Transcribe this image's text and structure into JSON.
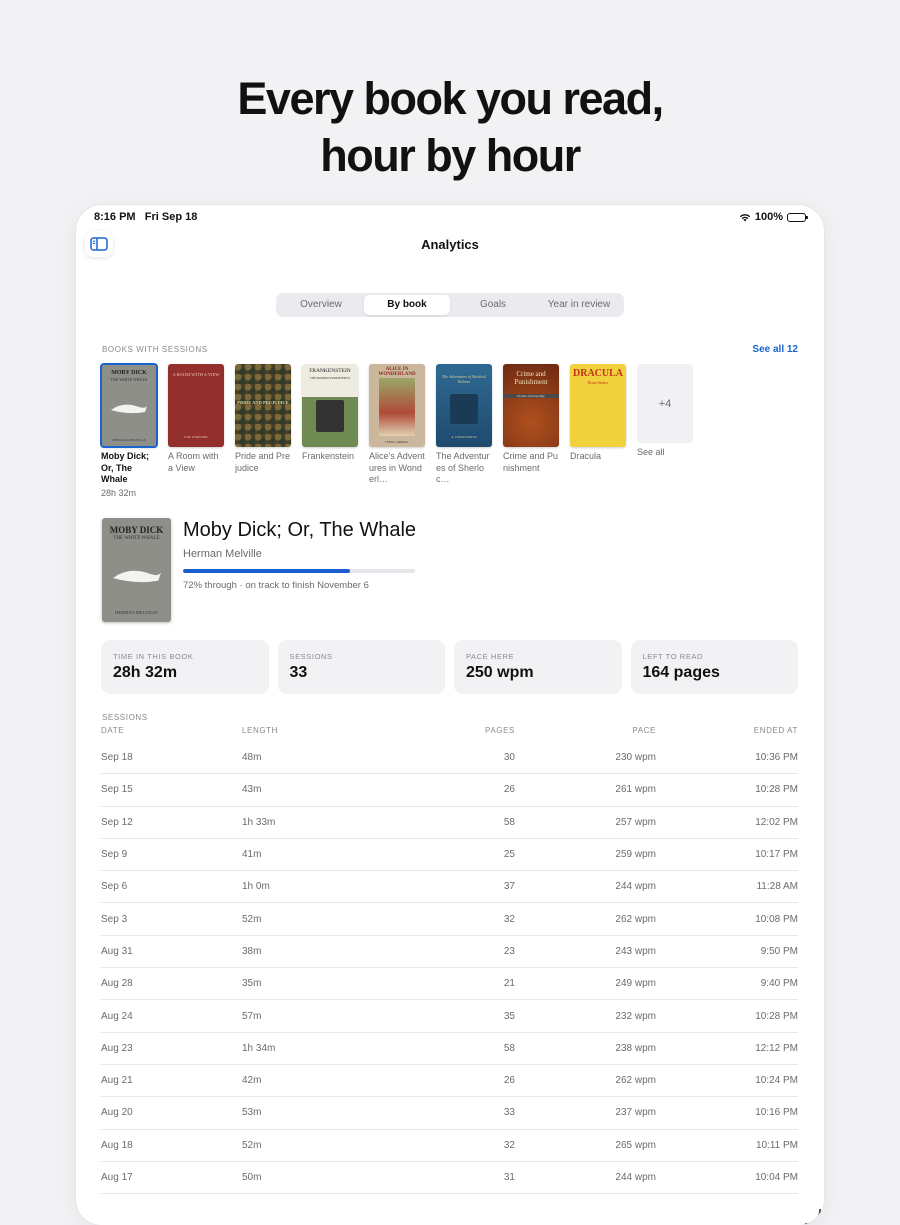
{
  "headline": {
    "line1": "Every book you read,",
    "line2": "hour by hour"
  },
  "status": {
    "time": "8:16 PM",
    "date": "Fri Sep 18",
    "battery": "100%"
  },
  "nav": {
    "title": "Analytics"
  },
  "tabs": [
    {
      "label": "Overview",
      "active": false
    },
    {
      "label": "By book",
      "active": true
    },
    {
      "label": "Goals",
      "active": false
    },
    {
      "label": "Year in review",
      "active": false
    }
  ],
  "books_section": {
    "label": "BOOKS WITH SESSIONS",
    "see_all": "See all 12"
  },
  "books": [
    {
      "title": "Moby Dick; Or, The Whale",
      "hours": "28h 32m",
      "cover_text": "MOBY DICK",
      "cover_color": "#8a8a86"
    },
    {
      "title": "A Room with a View",
      "cover_text": "A ROOM WITH A VIEW",
      "cover_color": "#8e2b2a"
    },
    {
      "title": "Pride and Prejudice",
      "cover_text": "PRIDE AND PREJUDICE",
      "cover_color": "#5a4a2a"
    },
    {
      "title": "Frankenstein",
      "cover_text": "FRANKENSTEIN",
      "cover_color": "#e9e6dc"
    },
    {
      "title": "Alice's Adventures in Wonderl…",
      "cover_text": "ALICE IN WONDERLAND",
      "cover_color": "#c8b8a0"
    },
    {
      "title": "The Adventures of Sherloc…",
      "cover_text": "THE ADVENTURES OF SHERLOCK HOLMES",
      "cover_color": "#2a5f86"
    },
    {
      "title": "Crime and Punishment",
      "cover_text": "Crime and Punishment",
      "cover_color": "#8c3a1c"
    },
    {
      "title": "Dracula",
      "cover_text": "DRACULA",
      "cover_color": "#f0d040"
    }
  ],
  "more": {
    "count": "+4",
    "label": "See all"
  },
  "detail": {
    "title": "Moby Dick; Or, The Whale",
    "author": "Herman Melville",
    "progress": 0.72,
    "progress_text": "72% through · on track to finish November 6"
  },
  "stats": [
    {
      "label": "TIME IN THIS BOOK",
      "value": "28h 32m"
    },
    {
      "label": "SESSIONS",
      "value": "33"
    },
    {
      "label": "PACE HERE",
      "value": "250 wpm"
    },
    {
      "label": "LEFT TO READ",
      "value": "164 pages"
    }
  ],
  "sessions": {
    "label": "SESSIONS",
    "columns": [
      "DATE",
      "LENGTH",
      "PAGES",
      "PACE",
      "ENDED AT"
    ],
    "rows": [
      [
        "Sep 18",
        "48m",
        "30",
        "230 wpm",
        "10:36 PM"
      ],
      [
        "Sep 15",
        "43m",
        "26",
        "261 wpm",
        "10:28 PM"
      ],
      [
        "Sep 12",
        "1h 33m",
        "58",
        "257 wpm",
        "12:02 PM"
      ],
      [
        "Sep 9",
        "41m",
        "25",
        "259 wpm",
        "10:17 PM"
      ],
      [
        "Sep 6",
        "1h 0m",
        "37",
        "244 wpm",
        "11:28 AM"
      ],
      [
        "Sep 3",
        "52m",
        "32",
        "262 wpm",
        "10:08 PM"
      ],
      [
        "Aug 31",
        "38m",
        "23",
        "243 wpm",
        "9:50 PM"
      ],
      [
        "Aug 28",
        "35m",
        "21",
        "249 wpm",
        "9:40 PM"
      ],
      [
        "Aug 24",
        "57m",
        "35",
        "232 wpm",
        "10:28 PM"
      ],
      [
        "Aug 23",
        "1h 34m",
        "58",
        "238 wpm",
        "12:12 PM"
      ],
      [
        "Aug 21",
        "42m",
        "26",
        "262 wpm",
        "10:24 PM"
      ],
      [
        "Aug 20",
        "53m",
        "33",
        "237 wpm",
        "10:16 PM"
      ],
      [
        "Aug 18",
        "52m",
        "32",
        "265 wpm",
        "10:11 PM"
      ],
      [
        "Aug 17",
        "50m",
        "31",
        "244 wpm",
        "10:04 PM"
      ]
    ]
  },
  "colors": {
    "accent": "#1b63cf",
    "background": "#f2f2f4"
  }
}
